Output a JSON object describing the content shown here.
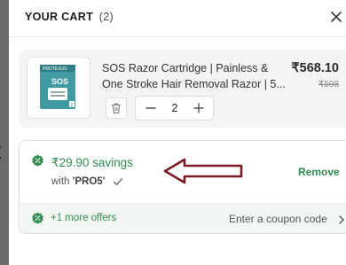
{
  "background_page": {
    "partial_text": "t"
  },
  "cart": {
    "title": "YOUR CART",
    "count": "(2)"
  },
  "item": {
    "name": "SOS Razor Cartridge | Painless & One Stroke Hair Removal Razor | 5...",
    "price": "₹568.10",
    "mrp": "₹598",
    "quantity": "2",
    "thumb_brand": "PROTEXUS",
    "thumb_label": "SOS",
    "thumb_count": "2"
  },
  "offer": {
    "savings": "₹29.90 savings",
    "with_label": "with",
    "coupon_code": "'PRO5'",
    "remove_label": "Remove"
  },
  "offers_bar": {
    "more_offers": "+1 more offers",
    "coupon_entry": "Enter a coupon code"
  },
  "colors": {
    "accent_green": "#2f8c50",
    "annotation_arrow": "#7a1a24"
  },
  "icons": [
    "close-icon",
    "trash-icon",
    "minus-icon",
    "plus-icon",
    "discount-badge-icon",
    "check-icon",
    "chevron-right-icon"
  ]
}
